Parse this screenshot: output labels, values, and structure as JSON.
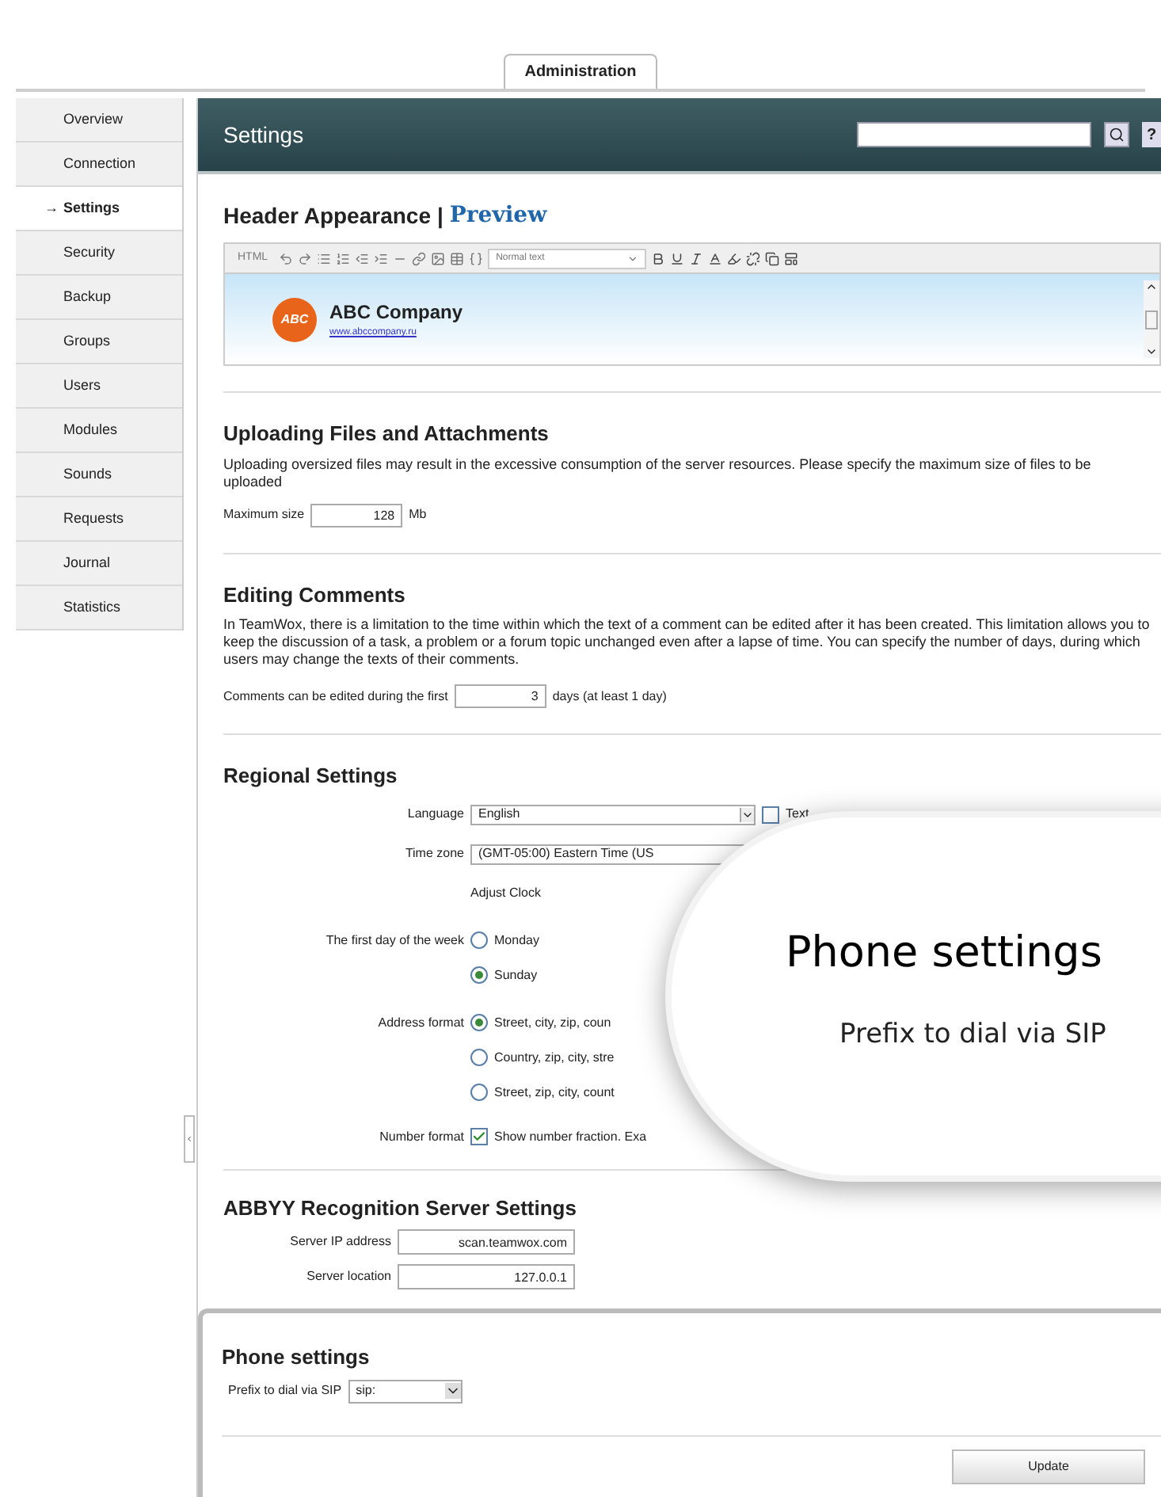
{
  "tabs": [
    {
      "label": "Administration",
      "selected": true
    }
  ],
  "sidebar": {
    "items": [
      {
        "label": "Overview",
        "selected": false
      },
      {
        "label": "Connection",
        "selected": false
      },
      {
        "label": "Settings",
        "selected": true
      },
      {
        "label": "Security",
        "selected": false
      },
      {
        "label": "Backup",
        "selected": false
      },
      {
        "label": "Groups",
        "selected": false
      },
      {
        "label": "Users",
        "selected": false
      },
      {
        "label": "Modules",
        "selected": false
      },
      {
        "label": "Sounds",
        "selected": false
      },
      {
        "label": "Requests",
        "selected": false
      },
      {
        "label": "Journal",
        "selected": false
      },
      {
        "label": "Statistics",
        "selected": false
      }
    ],
    "current_marker": "→"
  },
  "header": {
    "title": "Settings",
    "help": "?"
  },
  "header_appearance": {
    "title": "Header Appearance",
    "separator": "|",
    "link": "Preview",
    "toolbar": {
      "mode": "HTML",
      "style": "Normal text"
    },
    "logo_text": "ABC",
    "company": "ABC Company",
    "url": "www.abccompany.ru"
  },
  "uploading": {
    "title": "Uploading Files and Attachments",
    "description": "Uploading oversized files may result in the excessive consumption of the server resources. Please specify the maximum size of files to be uploaded",
    "label": "Maximum size",
    "value": "128",
    "unit": "Mb"
  },
  "editing_comments": {
    "title": "Editing Comments",
    "description": "In TeamWox, there is a limitation to the time within which the text of a comment can be edited after it has been created. This limitation allows you to keep the discussion of a task, a problem or a forum topic unchanged even after a lapse of time. You can specify the number of days, during which users may change the texts of their comments.",
    "label": "Comments can be edited during the first",
    "value": "3",
    "unit": "days (at least 1 day)"
  },
  "regional": {
    "title": "Regional Settings",
    "language": {
      "label": "Language",
      "value": "English",
      "checkbox_label": "Text",
      "checked": false
    },
    "time_zone": {
      "label": "Time zone",
      "value": "(GMT-05:00) Eastern Time (US",
      "link": "Adjust Clock"
    },
    "first_day": {
      "label": "The first day of the week",
      "options": [
        {
          "label": "Monday",
          "selected": false
        },
        {
          "label": "Sunday",
          "selected": true
        }
      ]
    },
    "address_format": {
      "label": "Address format",
      "options": [
        {
          "label": "Street, city, zip, coun",
          "selected": true
        },
        {
          "label": "Country, zip, city, stre",
          "selected": false
        },
        {
          "label": "Street, zip, city, count",
          "selected": false
        }
      ]
    },
    "number_format": {
      "label": "Number format",
      "checkbox_label": "Show number fraction. Exa",
      "checked": true
    }
  },
  "abbyy": {
    "title": "ABBYY Recognition Server Settings",
    "fields": [
      {
        "label": "Server IP address",
        "value": "scan.teamwox.com"
      },
      {
        "label": "Server location",
        "value": "127.0.0.1"
      }
    ]
  },
  "phone": {
    "title": "Phone settings",
    "label": "Prefix to dial via SIP",
    "value": "sip:"
  },
  "buttons": [
    "Update"
  ],
  "magnifier": {
    "title": "Phone settings",
    "label": "Prefix to dial via SIP"
  }
}
